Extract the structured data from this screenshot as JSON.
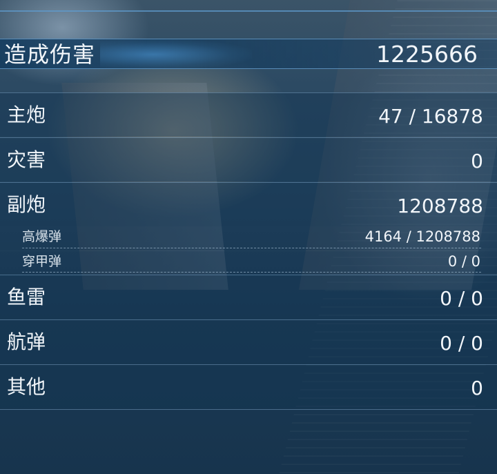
{
  "total": {
    "label": "造成伤害",
    "value": "1225666"
  },
  "rows": [
    {
      "label": "主炮",
      "value": "47 / 16878"
    },
    {
      "label": "灾害",
      "value": "0"
    },
    {
      "label": "副炮",
      "value": "1208788"
    }
  ],
  "sub_rows": [
    {
      "label": "高爆弹",
      "value": "4164 / 1208788"
    },
    {
      "label": "穿甲弹",
      "value": "0 / 0"
    }
  ],
  "rows_lower": [
    {
      "label": "鱼雷",
      "value": "0 / 0"
    },
    {
      "label": "航弹",
      "value": "0 / 0"
    },
    {
      "label": "其他",
      "value": "0"
    }
  ]
}
